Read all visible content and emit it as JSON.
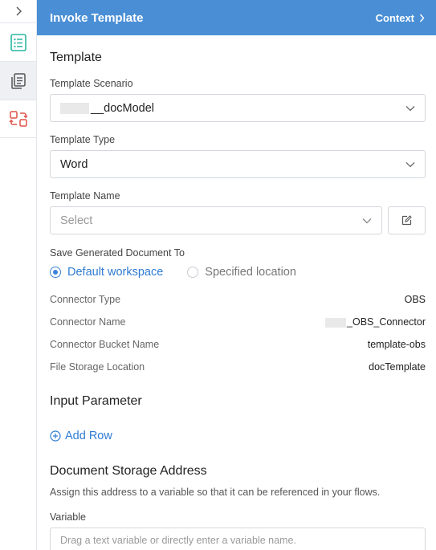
{
  "header": {
    "title": "Invoke Template",
    "context_link": "Context"
  },
  "rail": {
    "items": [
      "list-icon",
      "document-icon",
      "swap-icon"
    ]
  },
  "template": {
    "section_title": "Template",
    "scenario": {
      "label": "Template Scenario",
      "value": "__docModel"
    },
    "type": {
      "label": "Template Type",
      "value": "Word"
    },
    "name": {
      "label": "Template Name",
      "placeholder": "Select"
    }
  },
  "save": {
    "label": "Save Generated Document To",
    "options": [
      "Default workspace",
      "Specified location"
    ],
    "selected": "Default workspace"
  },
  "details": [
    {
      "key": "Connector Type",
      "value": "OBS"
    },
    {
      "key": "Connector Name",
      "value": "_OBS_Connector"
    },
    {
      "key": "Connector Bucket Name",
      "value": "template-obs"
    },
    {
      "key": "File Storage Location",
      "value": "docTemplate"
    }
  ],
  "input_parameter": {
    "section_title": "Input Parameter",
    "add_row": "Add Row"
  },
  "storage": {
    "section_title": "Document Storage Address",
    "help": "Assign this address to a variable so that it can be referenced in your flows.",
    "variable_label": "Variable",
    "variable_placeholder": "Drag a text variable or directly enter a variable name."
  },
  "colors": {
    "header": "#4a8fd6",
    "accent": "#2f7bd2",
    "rail_icon_green": "#2bb5a0",
    "rail_icon_red": "#e0524a"
  }
}
